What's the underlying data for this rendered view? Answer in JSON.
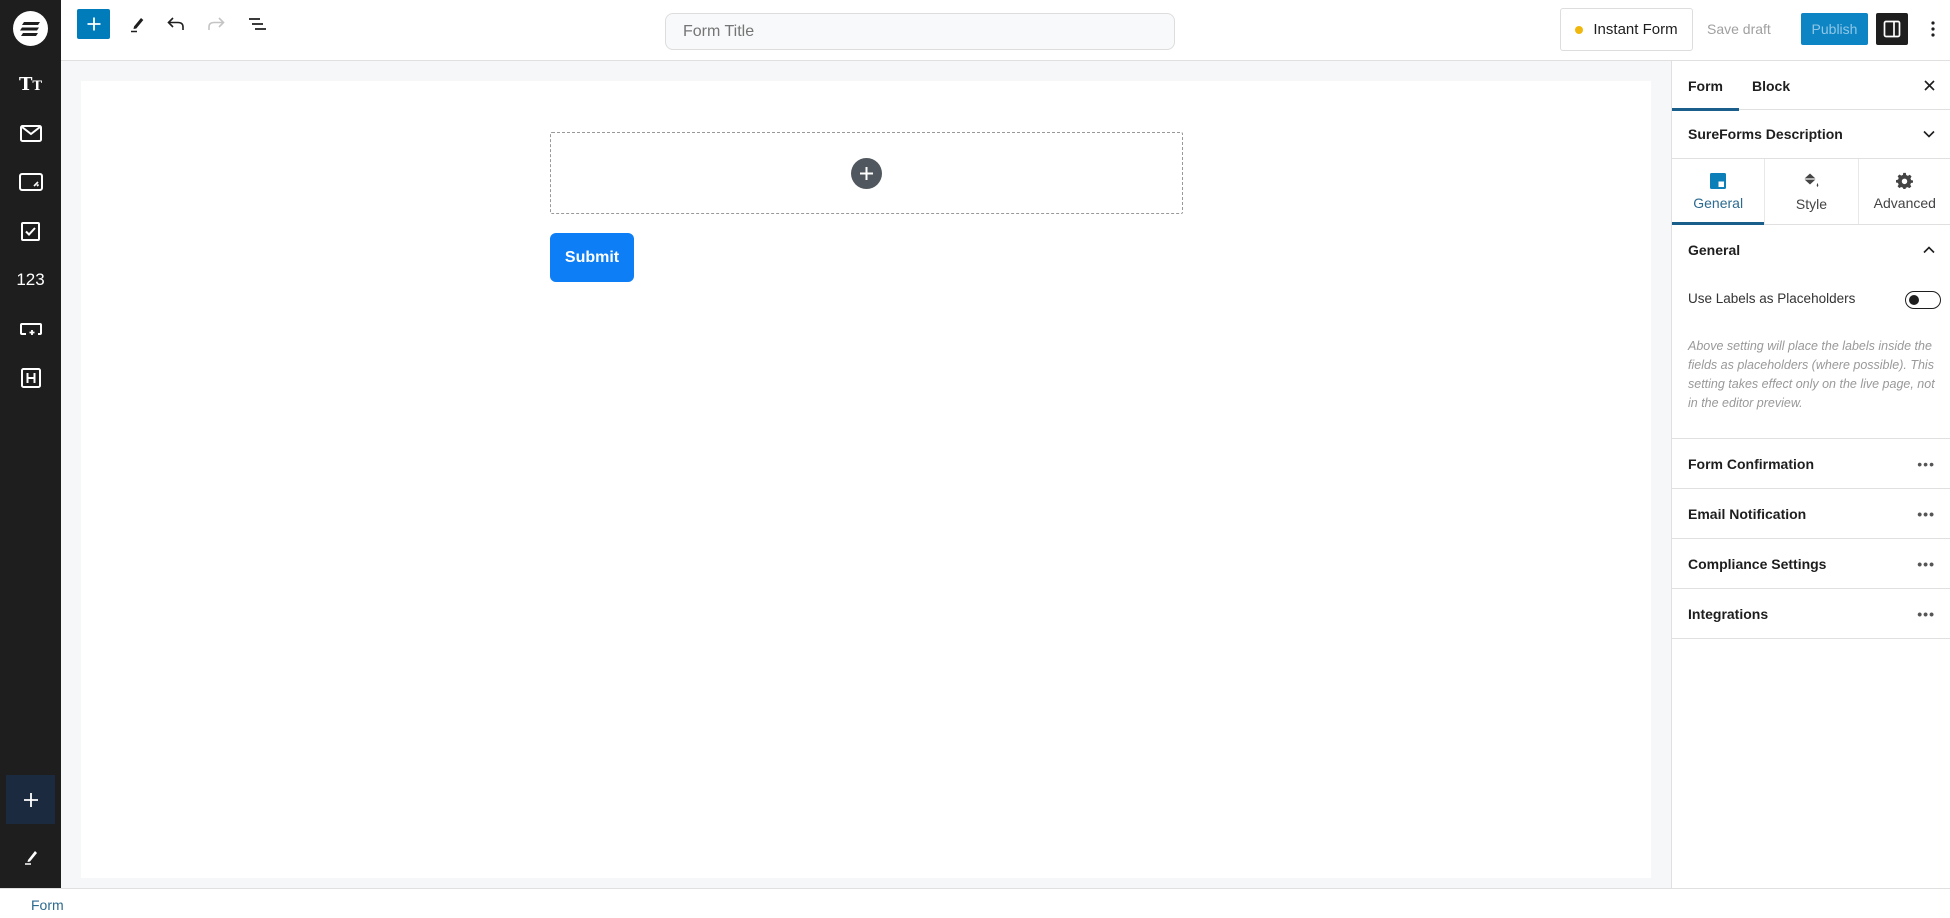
{
  "sidebar": {
    "logo": "sureforms-logo",
    "items": [
      {
        "name": "text-field",
        "icon": "typography-icon",
        "label": "Tт"
      },
      {
        "name": "email-field",
        "icon": "envelope-icon"
      },
      {
        "name": "textarea-field",
        "icon": "textarea-icon"
      },
      {
        "name": "checkbox-field",
        "icon": "checkbox-icon"
      },
      {
        "name": "number-field",
        "icon": "number-icon",
        "label": "123"
      },
      {
        "name": "dropdown-field",
        "icon": "dropdown-icon"
      },
      {
        "name": "heading-field",
        "icon": "heading-icon"
      }
    ],
    "bottom": [
      {
        "name": "add-block",
        "icon": "plus-icon"
      },
      {
        "name": "edit",
        "icon": "pencil-icon"
      }
    ]
  },
  "header": {
    "toolbar": [
      {
        "name": "block-inserter",
        "icon": "plus-icon"
      },
      {
        "name": "tools",
        "icon": "pencil-icon"
      },
      {
        "name": "undo",
        "icon": "undo-icon"
      },
      {
        "name": "redo",
        "icon": "redo-icon",
        "disabled": true
      },
      {
        "name": "document-overview",
        "icon": "list-view-icon"
      }
    ],
    "title_placeholder": "Form Title",
    "title_value": "",
    "instant_form_label": "Instant Form",
    "instant_form_status_color": "#f0b80e",
    "save_draft_label": "Save draft",
    "publish_label": "Publish",
    "accent_color": "#007cba"
  },
  "canvas": {
    "submit_label": "Submit"
  },
  "panel": {
    "tabs": [
      {
        "label": "Form",
        "active": true
      },
      {
        "label": "Block",
        "active": false
      }
    ],
    "description_label": "SureForms Description",
    "subtabs": [
      {
        "label": "General",
        "icon": "layout-icon",
        "active": true
      },
      {
        "label": "Style",
        "icon": "paint-bucket-icon",
        "active": false
      },
      {
        "label": "Advanced",
        "icon": "gear-icon",
        "active": false
      }
    ],
    "general": {
      "title": "General",
      "toggle_label": "Use Labels as Placeholders",
      "toggle_on": false,
      "help_text": "Above setting will place the labels inside the fields as placeholders (where possible). This setting takes effect only on the live page, not in the editor preview."
    },
    "sections": [
      {
        "label": "Form Confirmation"
      },
      {
        "label": "Email Notification"
      },
      {
        "label": "Compliance Settings"
      },
      {
        "label": "Integrations"
      }
    ]
  },
  "footer": {
    "breadcrumb": "Form"
  }
}
